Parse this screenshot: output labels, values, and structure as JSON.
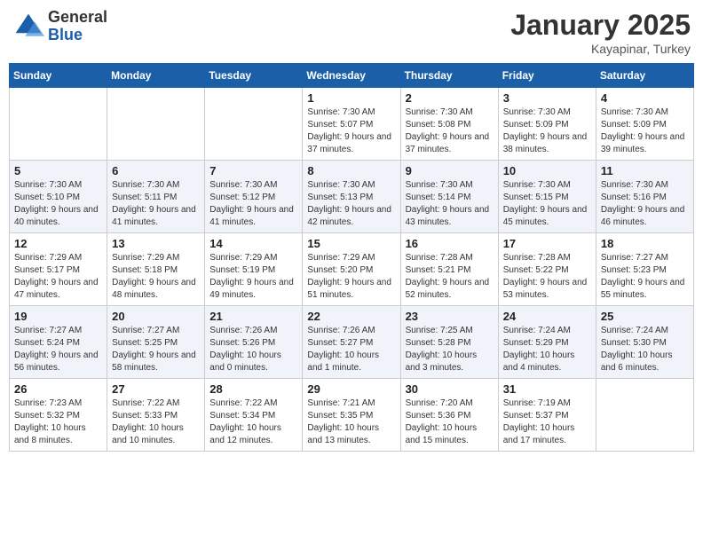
{
  "header": {
    "logo_general": "General",
    "logo_blue": "Blue",
    "month": "January 2025",
    "location": "Kayapinar, Turkey"
  },
  "weekdays": [
    "Sunday",
    "Monday",
    "Tuesday",
    "Wednesday",
    "Thursday",
    "Friday",
    "Saturday"
  ],
  "weeks": [
    [
      null,
      null,
      null,
      {
        "day": "1",
        "sunrise": "7:30 AM",
        "sunset": "5:07 PM",
        "daylight": "9 hours and 37 minutes."
      },
      {
        "day": "2",
        "sunrise": "7:30 AM",
        "sunset": "5:08 PM",
        "daylight": "9 hours and 37 minutes."
      },
      {
        "day": "3",
        "sunrise": "7:30 AM",
        "sunset": "5:09 PM",
        "daylight": "9 hours and 38 minutes."
      },
      {
        "day": "4",
        "sunrise": "7:30 AM",
        "sunset": "5:09 PM",
        "daylight": "9 hours and 39 minutes."
      }
    ],
    [
      {
        "day": "5",
        "sunrise": "7:30 AM",
        "sunset": "5:10 PM",
        "daylight": "9 hours and 40 minutes."
      },
      {
        "day": "6",
        "sunrise": "7:30 AM",
        "sunset": "5:11 PM",
        "daylight": "9 hours and 41 minutes."
      },
      {
        "day": "7",
        "sunrise": "7:30 AM",
        "sunset": "5:12 PM",
        "daylight": "9 hours and 41 minutes."
      },
      {
        "day": "8",
        "sunrise": "7:30 AM",
        "sunset": "5:13 PM",
        "daylight": "9 hours and 42 minutes."
      },
      {
        "day": "9",
        "sunrise": "7:30 AM",
        "sunset": "5:14 PM",
        "daylight": "9 hours and 43 minutes."
      },
      {
        "day": "10",
        "sunrise": "7:30 AM",
        "sunset": "5:15 PM",
        "daylight": "9 hours and 45 minutes."
      },
      {
        "day": "11",
        "sunrise": "7:30 AM",
        "sunset": "5:16 PM",
        "daylight": "9 hours and 46 minutes."
      }
    ],
    [
      {
        "day": "12",
        "sunrise": "7:29 AM",
        "sunset": "5:17 PM",
        "daylight": "9 hours and 47 minutes."
      },
      {
        "day": "13",
        "sunrise": "7:29 AM",
        "sunset": "5:18 PM",
        "daylight": "9 hours and 48 minutes."
      },
      {
        "day": "14",
        "sunrise": "7:29 AM",
        "sunset": "5:19 PM",
        "daylight": "9 hours and 49 minutes."
      },
      {
        "day": "15",
        "sunrise": "7:29 AM",
        "sunset": "5:20 PM",
        "daylight": "9 hours and 51 minutes."
      },
      {
        "day": "16",
        "sunrise": "7:28 AM",
        "sunset": "5:21 PM",
        "daylight": "9 hours and 52 minutes."
      },
      {
        "day": "17",
        "sunrise": "7:28 AM",
        "sunset": "5:22 PM",
        "daylight": "9 hours and 53 minutes."
      },
      {
        "day": "18",
        "sunrise": "7:27 AM",
        "sunset": "5:23 PM",
        "daylight": "9 hours and 55 minutes."
      }
    ],
    [
      {
        "day": "19",
        "sunrise": "7:27 AM",
        "sunset": "5:24 PM",
        "daylight": "9 hours and 56 minutes."
      },
      {
        "day": "20",
        "sunrise": "7:27 AM",
        "sunset": "5:25 PM",
        "daylight": "9 hours and 58 minutes."
      },
      {
        "day": "21",
        "sunrise": "7:26 AM",
        "sunset": "5:26 PM",
        "daylight": "10 hours and 0 minutes."
      },
      {
        "day": "22",
        "sunrise": "7:26 AM",
        "sunset": "5:27 PM",
        "daylight": "10 hours and 1 minute."
      },
      {
        "day": "23",
        "sunrise": "7:25 AM",
        "sunset": "5:28 PM",
        "daylight": "10 hours and 3 minutes."
      },
      {
        "day": "24",
        "sunrise": "7:24 AM",
        "sunset": "5:29 PM",
        "daylight": "10 hours and 4 minutes."
      },
      {
        "day": "25",
        "sunrise": "7:24 AM",
        "sunset": "5:30 PM",
        "daylight": "10 hours and 6 minutes."
      }
    ],
    [
      {
        "day": "26",
        "sunrise": "7:23 AM",
        "sunset": "5:32 PM",
        "daylight": "10 hours and 8 minutes."
      },
      {
        "day": "27",
        "sunrise": "7:22 AM",
        "sunset": "5:33 PM",
        "daylight": "10 hours and 10 minutes."
      },
      {
        "day": "28",
        "sunrise": "7:22 AM",
        "sunset": "5:34 PM",
        "daylight": "10 hours and 12 minutes."
      },
      {
        "day": "29",
        "sunrise": "7:21 AM",
        "sunset": "5:35 PM",
        "daylight": "10 hours and 13 minutes."
      },
      {
        "day": "30",
        "sunrise": "7:20 AM",
        "sunset": "5:36 PM",
        "daylight": "10 hours and 15 minutes."
      },
      {
        "day": "31",
        "sunrise": "7:19 AM",
        "sunset": "5:37 PM",
        "daylight": "10 hours and 17 minutes."
      },
      null
    ]
  ]
}
